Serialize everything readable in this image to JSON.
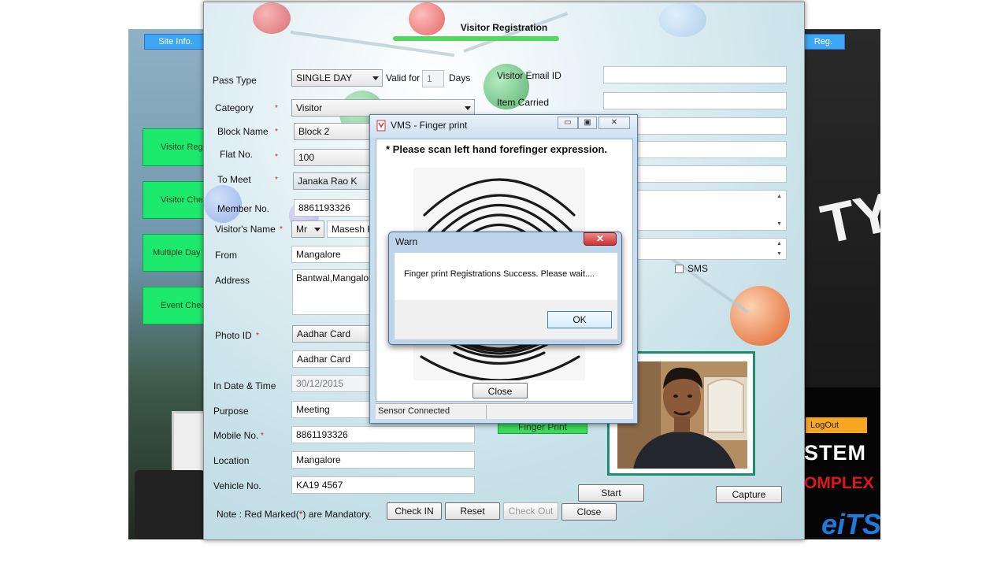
{
  "background_app": {
    "tabs": {
      "site_info": "Site Info.",
      "reg": "Reg."
    },
    "menu": [
      "Visitor Regi",
      "Visitor Che",
      "Multiple Day",
      "Event Check"
    ],
    "logout": "LogOut",
    "brand_line1": "STEM",
    "brand_line2": "OMPLEX",
    "brand_line3": "eiTS",
    "shirt_text": "TY"
  },
  "registration": {
    "title": "Visitor Registration",
    "pass_type": {
      "label": "Pass Type",
      "value": "SINGLE DAY"
    },
    "valid_for": {
      "label": "Valid for",
      "value": "1",
      "unit": "Days"
    },
    "category": {
      "label": "Category",
      "value": "Visitor"
    },
    "block_name": {
      "label": "Block Name",
      "value": "Block 2"
    },
    "flat_no": {
      "label": "Flat No.",
      "value": "100"
    },
    "to_meet": {
      "label": "To Meet",
      "value": "Janaka Rao K"
    },
    "member_no": {
      "label": "Member No.",
      "value": "8861193326"
    },
    "visitor_name": {
      "label": "Visitor's Name",
      "title": "Mr",
      "value": "Masesh K"
    },
    "from": {
      "label": "From",
      "value": "Mangalore"
    },
    "address": {
      "label": "Address",
      "value": "Bantwal,Mangalore"
    },
    "photo_id": {
      "label": "Photo ID",
      "value": "Aadhar Card",
      "value2": "Aadhar Card"
    },
    "in_date": {
      "label": "In Date & Time",
      "value": "30/12/2015"
    },
    "purpose": {
      "label": "Purpose",
      "value": "Meeting"
    },
    "mobile": {
      "label": "Mobile No.",
      "value": "8861193326"
    },
    "location": {
      "label": "Location",
      "value": "Mangalore"
    },
    "vehicle": {
      "label": "Vehicle No.",
      "value": "KA19 4567"
    },
    "note_prefix": "Note : Red Marked(",
    "note_star": "*",
    "note_suffix": ") are Mandatory.",
    "required_mark": "*",
    "email": {
      "label": "Visitor Email ID",
      "value": ""
    },
    "item_carried": {
      "label": "Item Carried",
      "value": ""
    },
    "sms_label": "SMS",
    "finger_print_btn": "Finger Print",
    "buttons": {
      "check_in": "Check IN",
      "reset": "Reset",
      "check_out": "Check Out",
      "close": "Close",
      "start": "Start",
      "capture": "Capture"
    }
  },
  "fingerprint_dialog": {
    "title": "VMS - Finger print",
    "instruction": "* Please scan left hand forefinger expression.",
    "close": "Close",
    "status": "Sensor Connected",
    "tb_min": "▭",
    "tb_max": "▣",
    "tb_close": "✕"
  },
  "warn_dialog": {
    "title": "Warn",
    "message": "Finger print Registrations  Success. Please wait....",
    "ok": "OK",
    "close_glyph": "✕"
  }
}
